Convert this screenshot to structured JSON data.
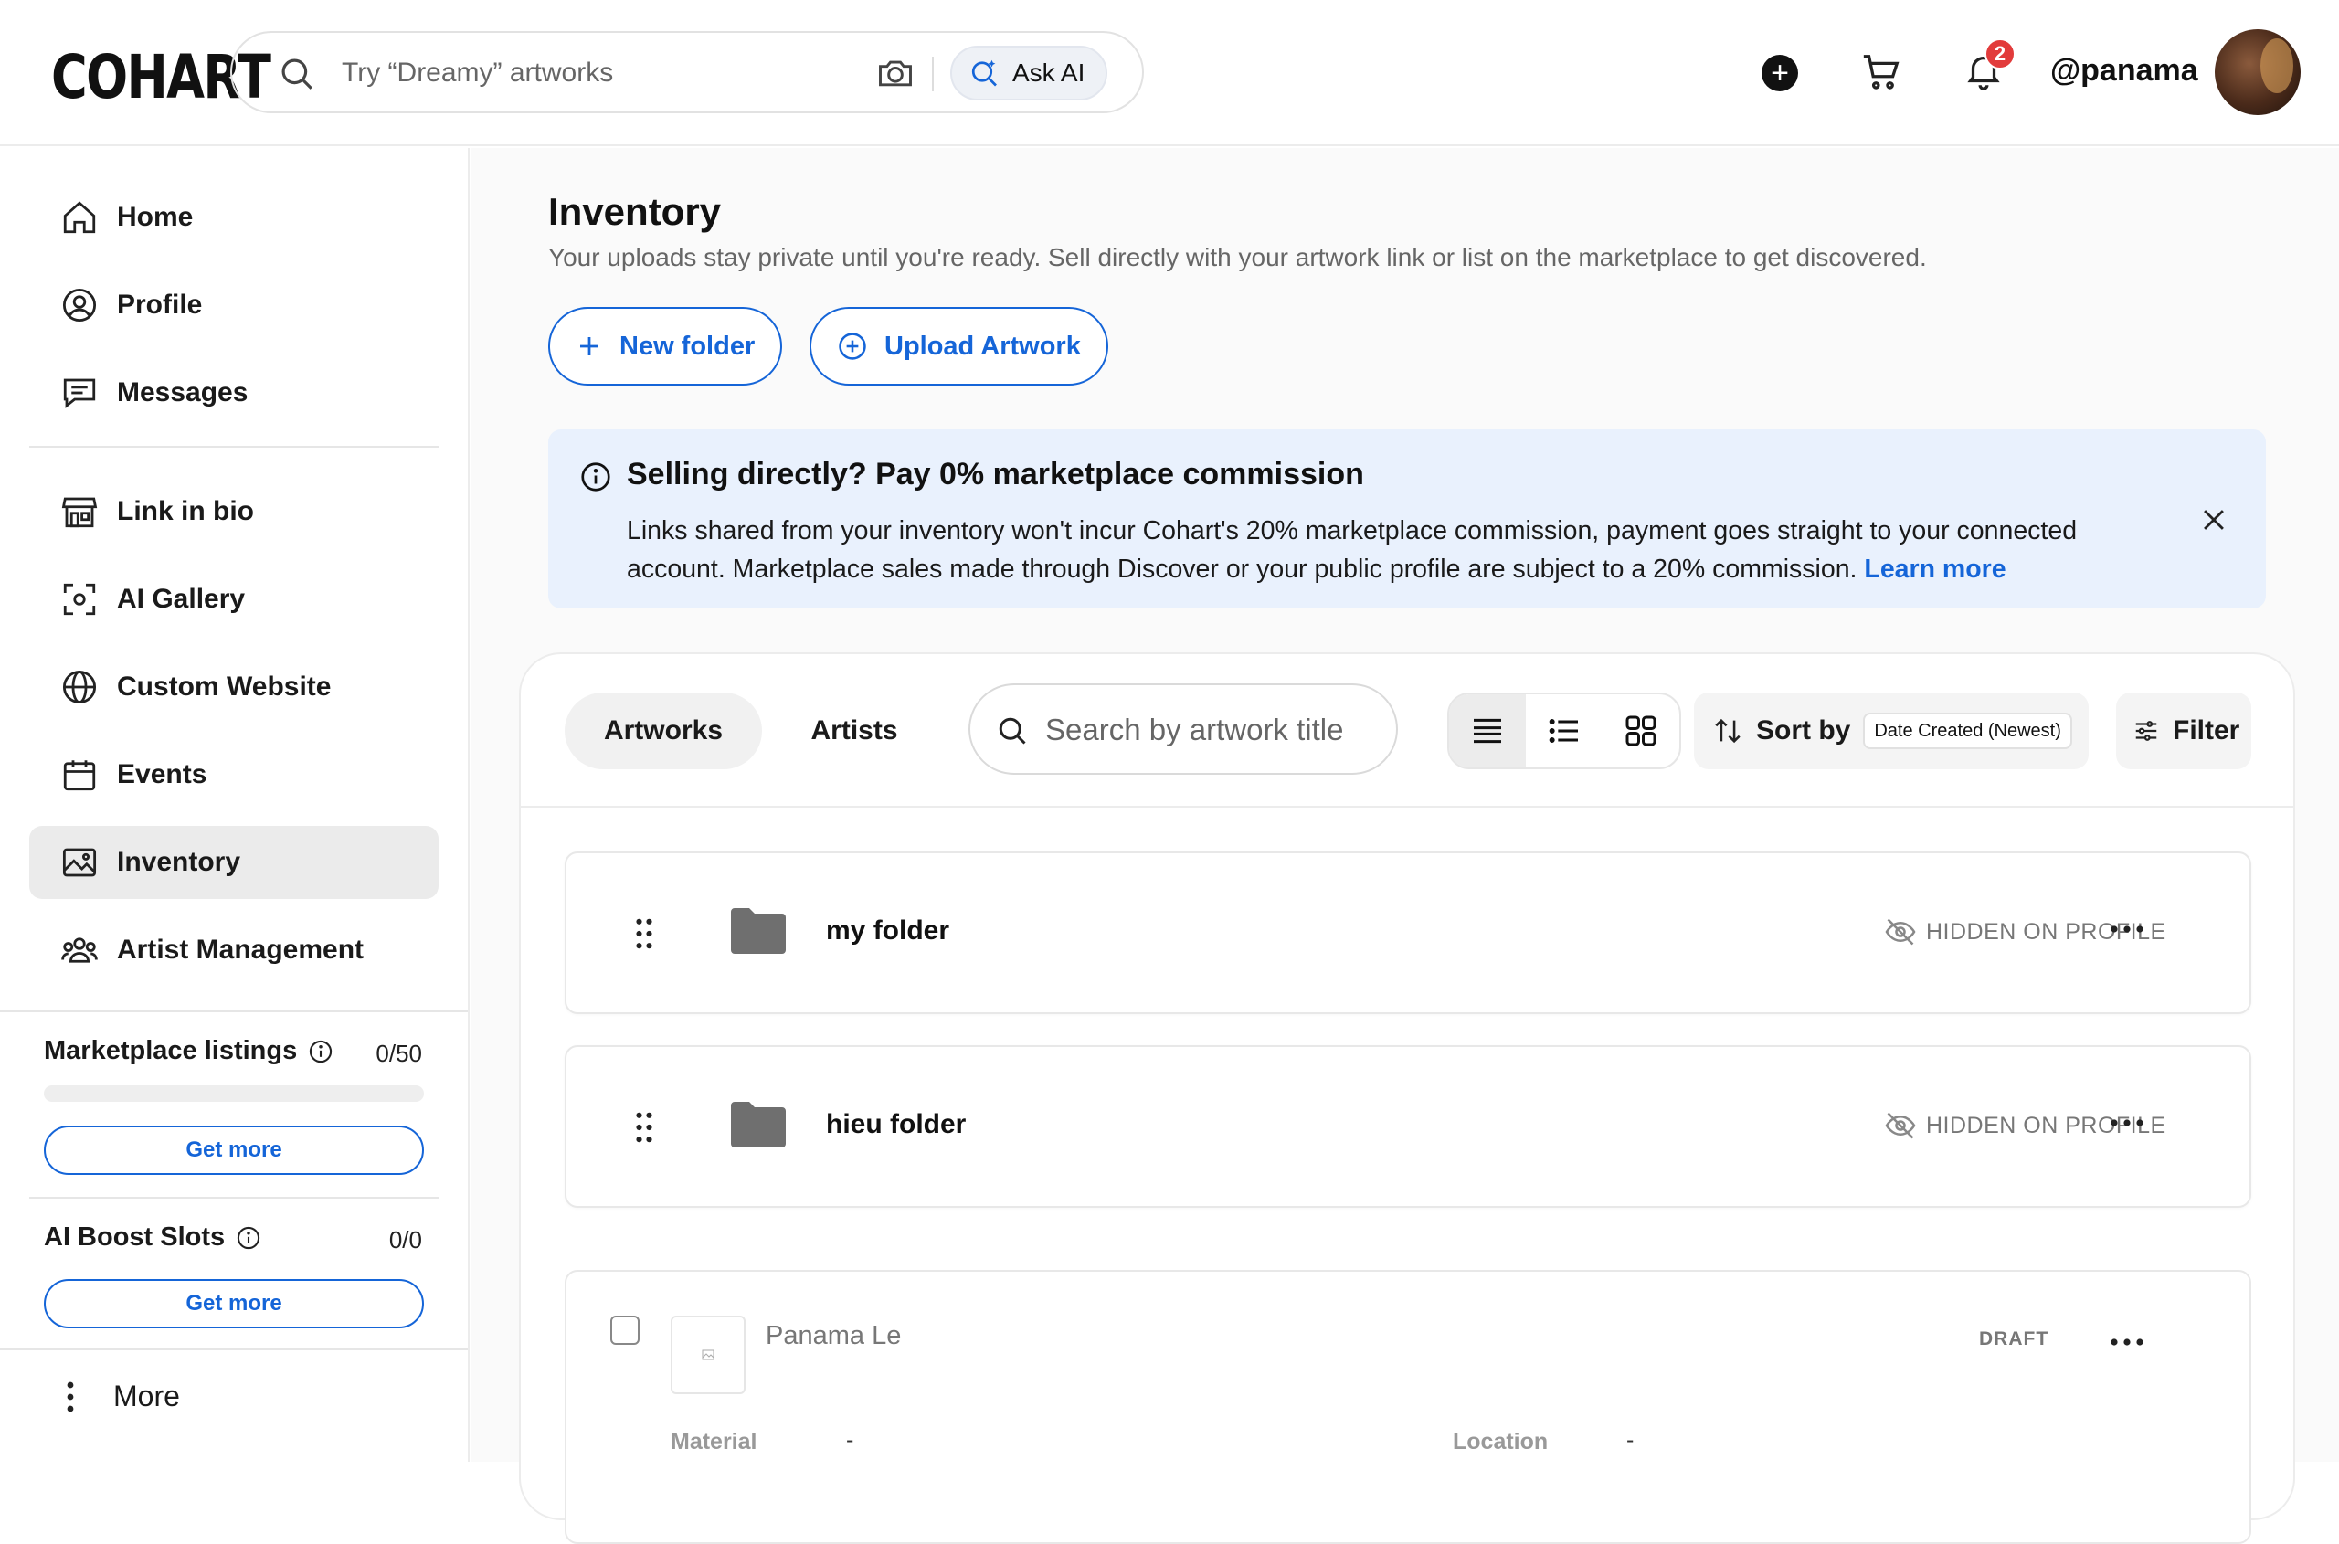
{
  "header": {
    "logo": "COHART",
    "search_placeholder": "Try “Dreamy” artworks",
    "ask_ai": "Ask AI",
    "notification_count": "2",
    "username": "@panama"
  },
  "sidebar": {
    "items": [
      {
        "label": "Home",
        "icon": "home-icon"
      },
      {
        "label": "Profile",
        "icon": "user-circle-icon"
      },
      {
        "label": "Messages",
        "icon": "message-icon"
      },
      {
        "label": "Link in bio",
        "icon": "storefront-icon"
      },
      {
        "label": "AI Gallery",
        "icon": "scan-icon"
      },
      {
        "label": "Custom Website",
        "icon": "globe-icon"
      },
      {
        "label": "Events",
        "icon": "calendar-icon"
      },
      {
        "label": "Inventory",
        "icon": "image-icon"
      },
      {
        "label": "Artist Management",
        "icon": "people-icon"
      }
    ],
    "active": "Inventory",
    "marketplace": {
      "label": "Marketplace listings",
      "value": "0/50",
      "progress": 0,
      "cta": "Get more"
    },
    "boost": {
      "label": "AI Boost Slots",
      "value": "0/0",
      "cta": "Get more"
    },
    "more": "More"
  },
  "main": {
    "title": "Inventory",
    "subtitle": "Your uploads stay private until you're ready. Sell directly with your artwork link or list on the marketplace to get discovered.",
    "new_folder": "New folder",
    "upload": "Upload Artwork",
    "banner": {
      "title": "Selling directly? Pay 0% marketplace commission",
      "text": "Links shared from your inventory won't incur Cohart's 20% marketplace commission, payment goes straight to your connected account. Marketplace sales made through Discover or your public profile are subject to a 20% commission.",
      "link": "Learn more"
    },
    "tabs": [
      "Artworks",
      "Artists"
    ],
    "active_tab": "Artworks",
    "search_placeholder": "Search by artwork title",
    "sort_label": "Sort by",
    "sort_value": "Date Created (Newest)",
    "filter": "Filter",
    "folders": [
      {
        "name": "my folder",
        "status": "HIDDEN ON PROFILE"
      },
      {
        "name": "hieu folder",
        "status": "HIDDEN ON PROFILE"
      }
    ],
    "artwork": {
      "name": "Panama Le",
      "status": "DRAFT",
      "material_label": "Material",
      "material_value": "-",
      "location_label": "Location",
      "location_value": "-"
    }
  },
  "colors": {
    "accent": "#1565d8",
    "banner_bg": "#e9f1fd",
    "badge": "#e23b3b"
  }
}
